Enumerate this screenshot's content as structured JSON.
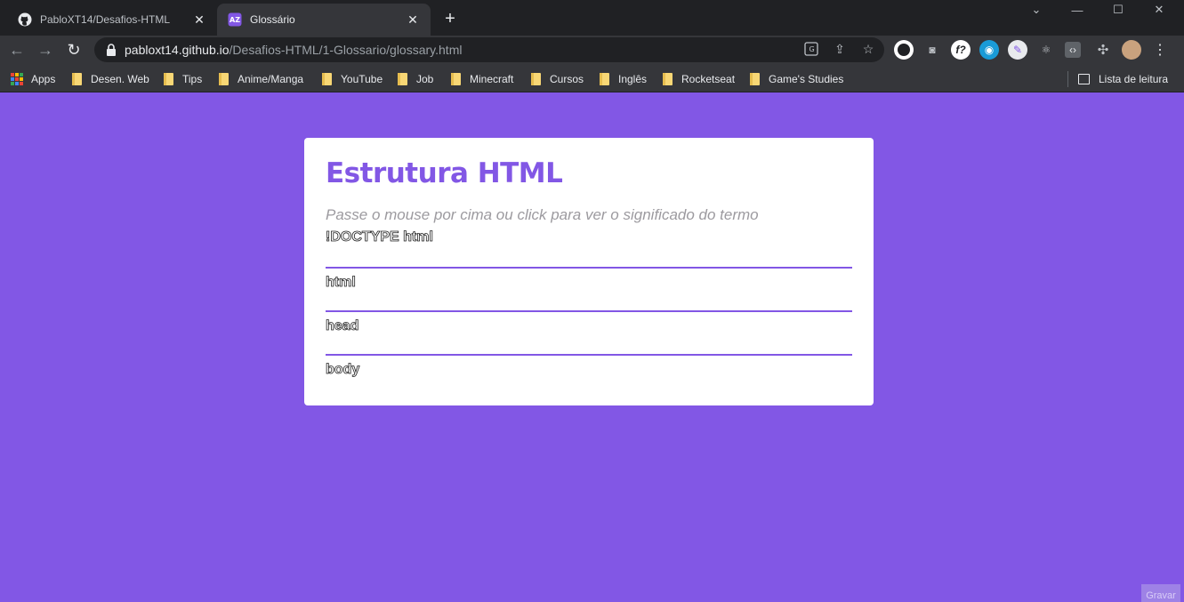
{
  "browser": {
    "tabs": [
      {
        "title": "PabloXT14/Desafios-HTML",
        "icon": "github-icon",
        "active": false
      },
      {
        "title": "Glossário",
        "icon": "glossary-favicon",
        "active": true
      }
    ],
    "url_host": "pabloxt14.github.io",
    "url_path": "/Desafios-HTML/1-Glossario/glossary.html",
    "bookmarks": [
      "Apps",
      "Desen. Web",
      "Tips",
      "Anime/Manga",
      "YouTube",
      "Job",
      "Minecraft",
      "Cursos",
      "Inglês",
      "Rocketseat",
      "Game's Studies"
    ],
    "reading_list": "Lista de leitura"
  },
  "page": {
    "title": "Estrutura HTML",
    "subtitle": "Passe o mouse por cima ou click para ver o significado do termo",
    "terms": [
      "!DOCTYPE html",
      "html",
      "head",
      "body"
    ],
    "corner_button": "Gravar"
  },
  "colors": {
    "accent": "#8257e5",
    "card_bg": "#ffffff",
    "subtitle": "#9c9a9f"
  }
}
